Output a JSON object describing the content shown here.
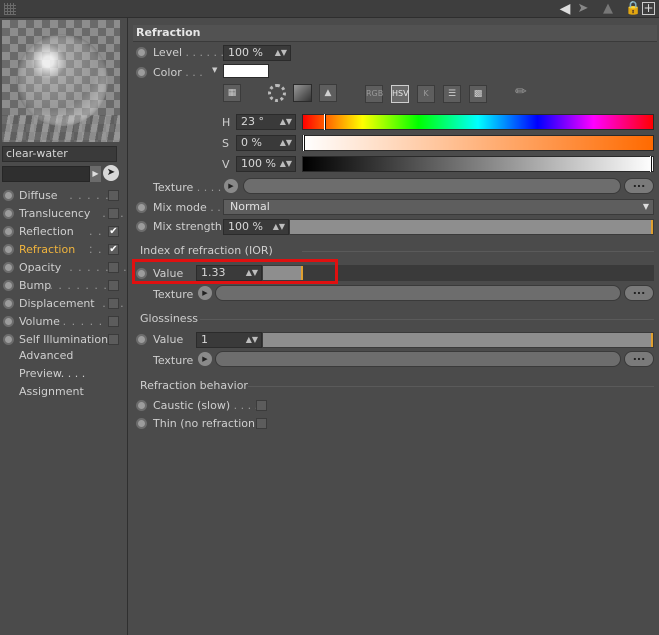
{
  "material_name": "clear-water",
  "channels": [
    {
      "label": "Diffuse",
      "dots": ". . . . .",
      "checked": false,
      "active": false
    },
    {
      "label": "Translucency",
      "dots": ". . .",
      "checked": false,
      "active": false
    },
    {
      "label": "Reflection",
      "dots": ". . . . .",
      "checked": true,
      "active": false
    },
    {
      "label": "Refraction",
      "dots": ". . . .",
      "checked": true,
      "active": true
    },
    {
      "label": "Opacity",
      "dots": ". . . . . . .",
      "checked": false,
      "active": false
    },
    {
      "label": "Bump",
      "dots": ". . . . . . . .",
      "checked": false,
      "active": false
    },
    {
      "label": "Displacement",
      "dots": ". . .",
      "checked": false,
      "active": false
    },
    {
      "label": "Volume",
      "dots": ". . . . . . .",
      "checked": false,
      "active": false
    },
    {
      "label": "Self Illumination",
      "dots": "",
      "checked": false,
      "active": false
    }
  ],
  "plain_items": [
    "Advanced",
    "Preview. . . .",
    "Assignment"
  ],
  "panel_title": "Refraction",
  "level": {
    "label": "Level",
    "dots": ". . . . . .",
    "value": "100 %"
  },
  "color": {
    "label": "Color",
    "dots": ". . .",
    "swatch": "#ffffff"
  },
  "color_tools": [
    "RGB",
    "HSV",
    "K"
  ],
  "hsv": {
    "h": {
      "label": "H",
      "value": "23 °",
      "marker_fraction": 0.064
    },
    "s": {
      "label": "S",
      "value": "0 %",
      "marker_fraction": 0.0
    },
    "v": {
      "label": "V",
      "value": "100 %",
      "marker_fraction": 1.0
    }
  },
  "texture_label": "Texture",
  "texture_dots": ". . . . .",
  "more_label": "...",
  "mix_mode": {
    "label": "Mix mode",
    "dots": ". . .",
    "value": "Normal"
  },
  "mix_strength": {
    "label": "Mix strength",
    "value": "100 %",
    "fraction": 1.0
  },
  "ior": {
    "section": "Index of refraction (IOR)",
    "label": "Value",
    "value": "1.33",
    "fraction": 0.102
  },
  "glossiness": {
    "section": "Glossiness",
    "label": "Value",
    "value": "1",
    "fraction": 1.0
  },
  "behavior": {
    "section": "Refraction behavior",
    "caustic": {
      "label": "Caustic (slow)",
      "dots": ". . . ."
    },
    "thin": {
      "label": "Thin (no refraction)"
    }
  },
  "colors": {
    "accent": "#f0b43d",
    "highlight": "#e01010",
    "background": "#4b4b4b"
  }
}
